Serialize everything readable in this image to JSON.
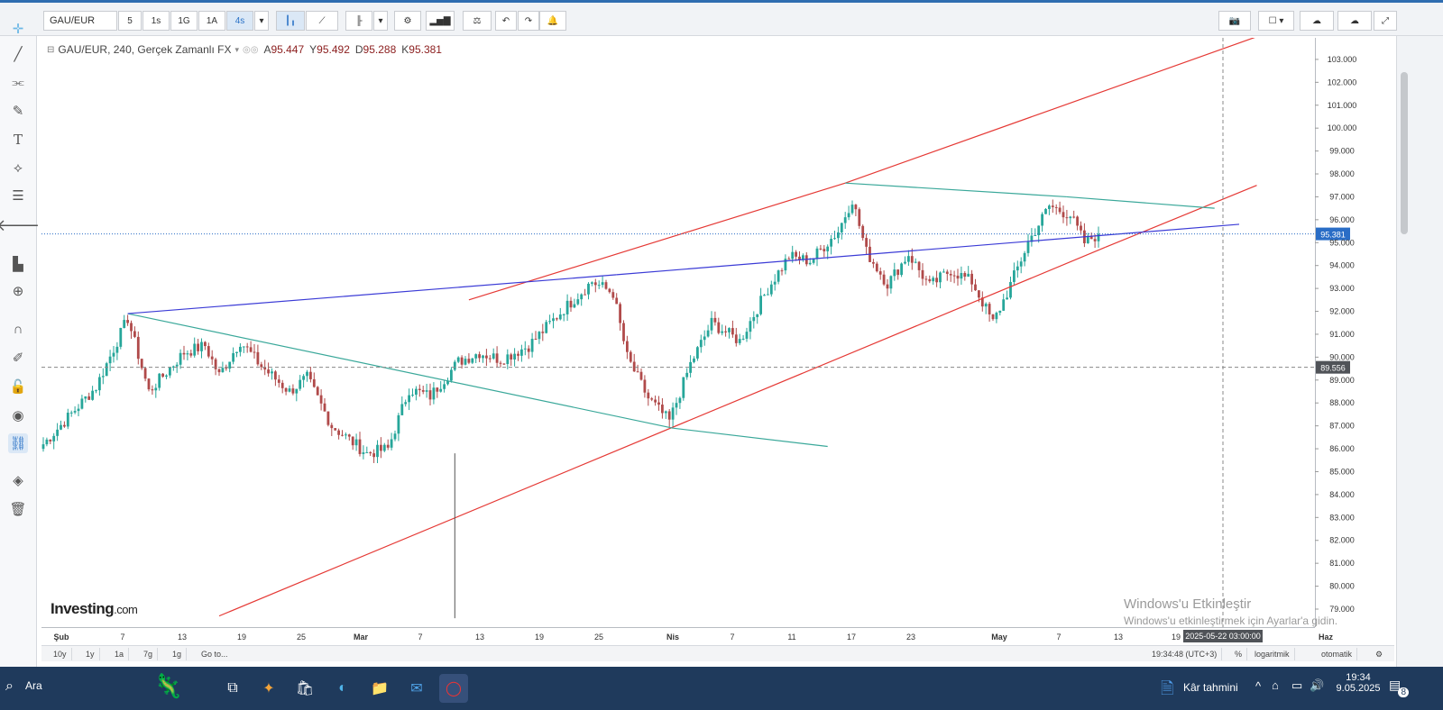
{
  "toolbar": {
    "symbol": "GAU/EUR",
    "intervals": [
      "5",
      "1s",
      "1G",
      "1A",
      "4s"
    ],
    "active_interval": "4s"
  },
  "legend": {
    "title": "GAU/EUR, 240, Gerçek Zamanlı FX",
    "a_label": "A",
    "a_value": "95.447",
    "y_label": "Y",
    "y_value": "95.492",
    "d_label": "D",
    "d_value": "95.288",
    "k_label": "K",
    "k_value": "95.381"
  },
  "colors": {
    "up": "#26a69a",
    "down": "#b04a4a",
    "channel": "#e53935",
    "trend_teal": "#3aa89a",
    "trend_blue": "#3b3bd6",
    "price_tag": "#2a6dc6",
    "crosshair": "#888888"
  },
  "chart_data": {
    "type": "candlestick",
    "y_axis": {
      "min": 78.5,
      "max": 103.5,
      "ticks": [
        "79.000",
        "80.000",
        "81.000",
        "82.000",
        "83.000",
        "84.000",
        "85.000",
        "86.000",
        "87.000",
        "88.000",
        "89.000",
        "90.000",
        "91.000",
        "92.000",
        "93.000",
        "94.000",
        "95.000",
        "96.000",
        "97.000",
        "98.000",
        "99.000",
        "100.000",
        "101.000",
        "102.000",
        "103.000"
      ]
    },
    "x_axis": {
      "labels": [
        "Şub",
        "7",
        "13",
        "19",
        "25",
        "Mar",
        "7",
        "13",
        "19",
        "25",
        "Nis",
        "7",
        "11",
        "17",
        "23",
        "May",
        "7",
        "13",
        "19",
        "Haz"
      ]
    },
    "current_price": "95.381",
    "crosshair_price": "89.556",
    "crosshair_time": "2025-05-22 03:00:00",
    "anchors": [
      {
        "i": 0,
        "p": 86.2
      },
      {
        "i": 15,
        "p": 88.7
      },
      {
        "i": 24,
        "p": 91.7
      },
      {
        "i": 30,
        "p": 88.5
      },
      {
        "i": 40,
        "p": 90.2
      },
      {
        "i": 46,
        "p": 90.5
      },
      {
        "i": 50,
        "p": 89.2
      },
      {
        "i": 56,
        "p": 90.7
      },
      {
        "i": 62,
        "p": 89.6
      },
      {
        "i": 70,
        "p": 88.5
      },
      {
        "i": 75,
        "p": 89.1
      },
      {
        "i": 82,
        "p": 87.0
      },
      {
        "i": 92,
        "p": 85.8
      },
      {
        "i": 98,
        "p": 86.0
      },
      {
        "i": 104,
        "p": 88.6
      },
      {
        "i": 110,
        "p": 88.3
      },
      {
        "i": 118,
        "p": 89.8
      },
      {
        "i": 124,
        "p": 90.2
      },
      {
        "i": 130,
        "p": 89.9
      },
      {
        "i": 138,
        "p": 90.5
      },
      {
        "i": 148,
        "p": 92.1
      },
      {
        "i": 156,
        "p": 93.3
      },
      {
        "i": 162,
        "p": 92.8
      },
      {
        "i": 166,
        "p": 90.0
      },
      {
        "i": 172,
        "p": 88.2
      },
      {
        "i": 178,
        "p": 87.2
      },
      {
        "i": 184,
        "p": 89.7
      },
      {
        "i": 190,
        "p": 91.5
      },
      {
        "i": 198,
        "p": 90.7
      },
      {
        "i": 206,
        "p": 93.0
      },
      {
        "i": 212,
        "p": 94.4
      },
      {
        "i": 218,
        "p": 94.2
      },
      {
        "i": 226,
        "p": 95.5
      },
      {
        "i": 230,
        "p": 96.9
      },
      {
        "i": 234,
        "p": 94.6
      },
      {
        "i": 240,
        "p": 93.2
      },
      {
        "i": 246,
        "p": 94.5
      },
      {
        "i": 252,
        "p": 93.1
      },
      {
        "i": 258,
        "p": 93.8
      },
      {
        "i": 264,
        "p": 93.3
      },
      {
        "i": 270,
        "p": 91.5
      },
      {
        "i": 274,
        "p": 92.8
      },
      {
        "i": 280,
        "p": 95.0
      },
      {
        "i": 286,
        "p": 96.6
      },
      {
        "i": 292,
        "p": 96.2
      },
      {
        "i": 296,
        "p": 95.0
      },
      {
        "i": 300,
        "p": 95.381
      }
    ],
    "lines": [
      {
        "kind": "channel",
        "t1": 50.0,
        "p1": 78.7,
        "t2": 302.0,
        "p2": 94.8
      },
      {
        "kind": "channel",
        "t1": 302.0,
        "p1": 94.8,
        "t2": 345.0,
        "p2": 97.5
      },
      {
        "kind": "channel",
        "t1": 121.0,
        "p1": 92.5,
        "t2": 228.0,
        "p2": 97.6
      },
      {
        "kind": "channel",
        "t1": 228.0,
        "p1": 97.6,
        "t2": 347.0,
        "p2": 104.1
      },
      {
        "kind": "teal",
        "t1": 24.0,
        "p1": 91.9,
        "t2": 179.0,
        "p2": 86.9
      },
      {
        "kind": "teal",
        "t1": 179.0,
        "p1": 86.9,
        "t2": 223.0,
        "p2": 86.1
      },
      {
        "kind": "teal",
        "t1": 228.0,
        "p1": 97.6,
        "t2": 291.0,
        "p2": 97.0
      },
      {
        "kind": "teal",
        "t1": 291.0,
        "p1": 97.0,
        "t2": 333.0,
        "p2": 96.5
      },
      {
        "kind": "blue",
        "t1": 24.0,
        "p1": 91.9,
        "t2": 163.0,
        "p2": 93.6
      },
      {
        "kind": "blue",
        "t1": 163.0,
        "p1": 93.6,
        "t2": 340.0,
        "p2": 95.8
      }
    ]
  },
  "watermark": {
    "brand": "Investing",
    "brand_suffix": ".com",
    "activation_title": "Windows'u Etkinleştir",
    "activation_sub": "Windows'u etkinleştirmek için Ayarlar'a gidin."
  },
  "bottom": {
    "ranges": [
      "10y",
      "1y",
      "1a",
      "7g",
      "1g"
    ],
    "goto": "Go to...",
    "time": "19:34:48 (UTC+3)",
    "percent": "%",
    "log": "logaritmik",
    "auto": "otomatik"
  },
  "taskbar": {
    "search": "Ara",
    "weather": "Kâr tahmini",
    "clock_time": "19:34",
    "clock_date": "9.05.2025",
    "notif_count": "8"
  }
}
